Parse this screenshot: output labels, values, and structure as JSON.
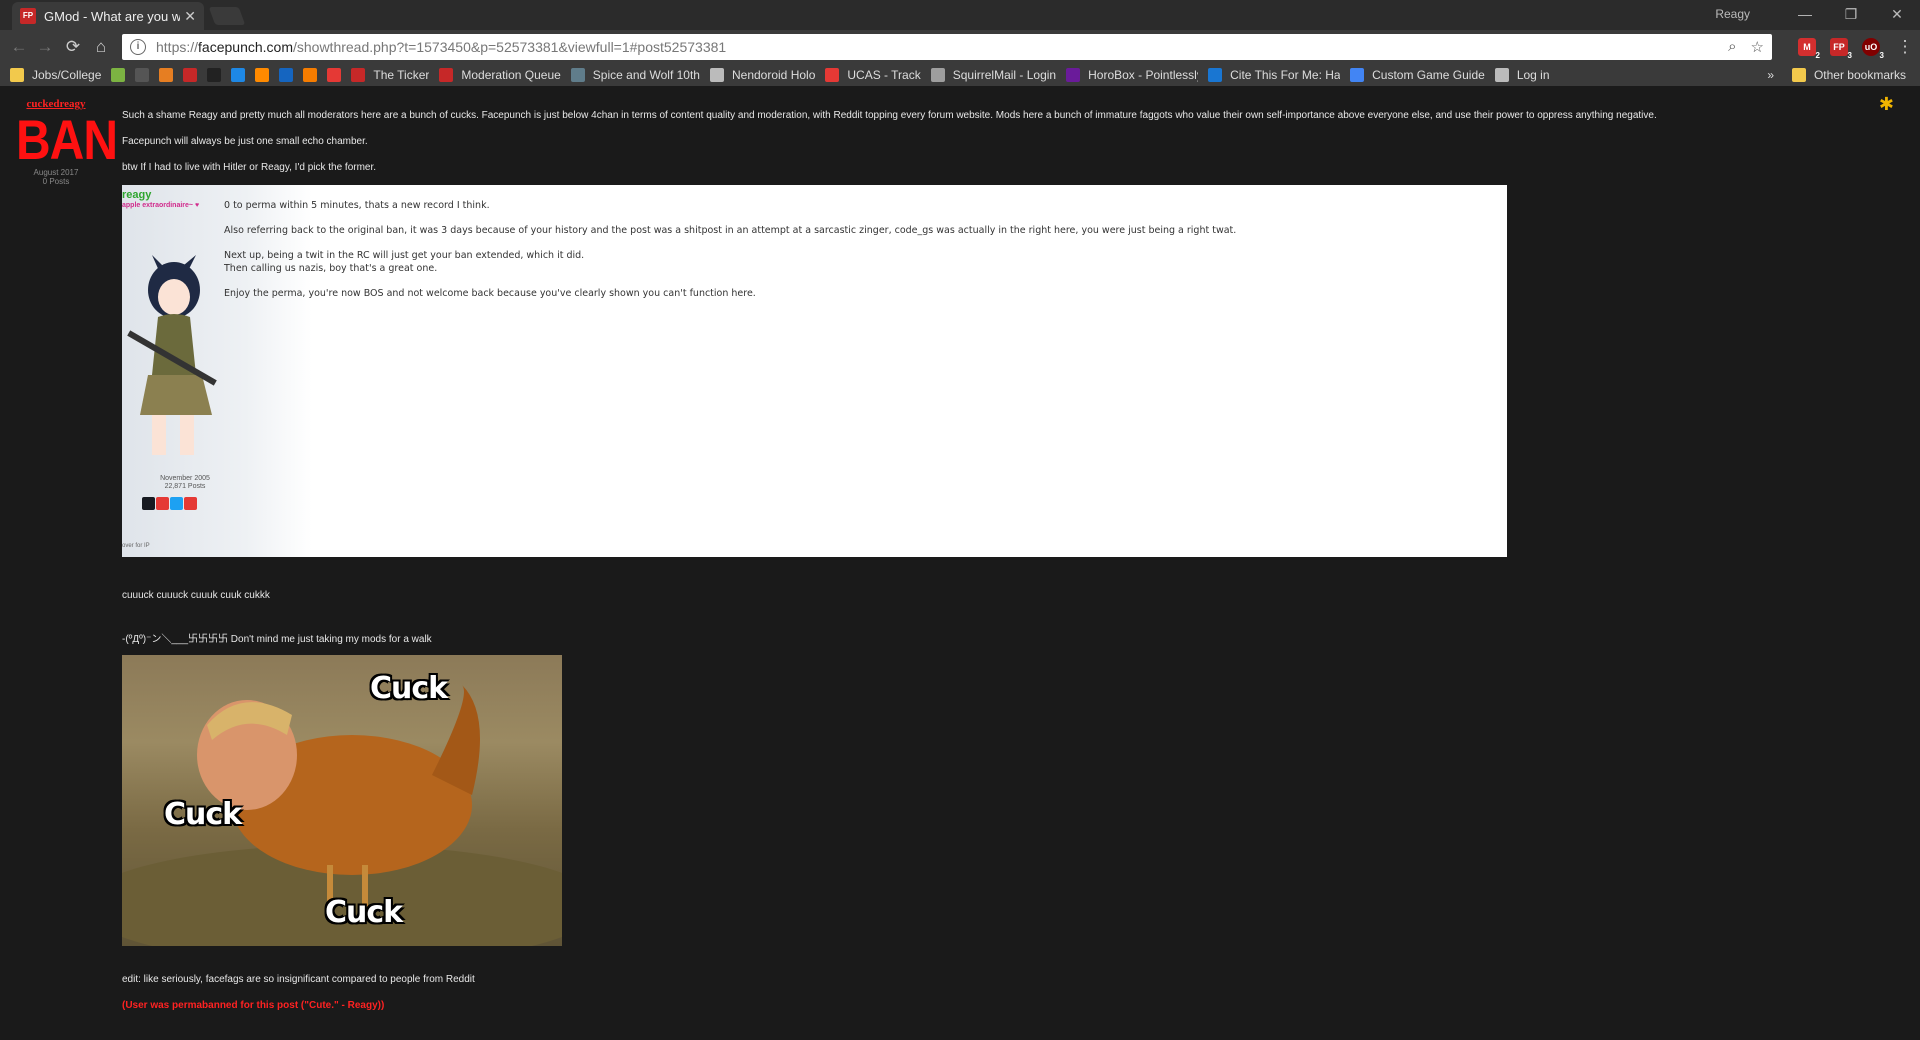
{
  "browser": {
    "tab_title": "GMod - What are you w",
    "favicon_text": "FP",
    "profile_name": "Reagy",
    "url_scheme": "https://",
    "url_host": "facepunch.com",
    "url_path": "/showthread.php?t=1573450&p=52573381&viewfull=1#post52573381",
    "extensions": [
      {
        "name": "gmail-icon",
        "badge": "2",
        "color": "#d32f2f"
      },
      {
        "name": "facepunch-icon",
        "badge": "3",
        "color": "#c62828"
      },
      {
        "name": "ublock-icon",
        "badge": "3",
        "color": "#800000"
      }
    ],
    "bookmarks": [
      {
        "label": "Jobs/College",
        "icon": "folder-icon",
        "color": "#f2c94c"
      },
      {
        "label": "",
        "icon": "bookmark-green-icon",
        "color": "#7cb342"
      },
      {
        "label": "",
        "icon": "bookmark-robot-icon",
        "color": "#555555"
      },
      {
        "label": "",
        "icon": "bookmark-orange-icon",
        "color": "#e67e22"
      },
      {
        "label": "",
        "icon": "bookmark-fp-icon",
        "color": "#c62828"
      },
      {
        "label": "",
        "icon": "amazon-icon",
        "color": "#222222"
      },
      {
        "label": "",
        "icon": "bookmark-blue-icon",
        "color": "#1e88e5"
      },
      {
        "label": "",
        "icon": "bookmark-fox-icon",
        "color": "#ff8a00"
      },
      {
        "label": "",
        "icon": "bookmark-n-icon",
        "color": "#1565c0"
      },
      {
        "label": "",
        "icon": "bookmark-flame-icon",
        "color": "#f57c00"
      },
      {
        "label": "",
        "icon": "youtube-icon",
        "color": "#e53935"
      },
      {
        "label": "The Ticker",
        "icon": "bookmark-fp-icon",
        "color": "#c62828"
      },
      {
        "label": "Moderation Queue",
        "icon": "bookmark-fp-icon",
        "color": "#c62828"
      },
      {
        "label": "Spice and Wolf 10th",
        "icon": "bookmark-x-icon",
        "color": "#607d8b"
      },
      {
        "label": "Nendoroid Holo",
        "icon": "page-icon",
        "color": "#bbbbbb"
      },
      {
        "label": "UCAS - Track",
        "icon": "ucas-icon",
        "color": "#e53935"
      },
      {
        "label": "SquirrelMail - Login",
        "icon": "squirrelmail-icon",
        "color": "#9e9e9e"
      },
      {
        "label": "HoroBox - Pointlessly",
        "icon": "horobox-icon",
        "color": "#6a1b9a"
      },
      {
        "label": "Cite This For Me: Har",
        "icon": "cite-icon",
        "color": "#1976d2"
      },
      {
        "label": "Custom Game Guide",
        "icon": "docs-icon",
        "color": "#4285f4"
      },
      {
        "label": "Log in",
        "icon": "page-icon",
        "color": "#bbbbbb"
      }
    ],
    "other_bookmarks": "Other bookmarks",
    "more_bookmarks": "»"
  },
  "post": {
    "username": "cuckedreagy",
    "ban_label": "BAN",
    "join_date": "August 2017",
    "post_count": "0 Posts",
    "paragraph1": "Such a shame Reagy and pretty much all moderators here are a bunch of cucks. Facepunch is just below 4chan in terms of content quality and moderation, with Reddit topping every forum website. Mods here a bunch of immature faggots who value their own self-importance above everyone else, and use their power to oppress anything negative.",
    "paragraph2": "Facepunch will always be just one small echo chamber.",
    "paragraph3": "btw If I had to live with Hitler or Reagy, I'd pick the former.",
    "quote": {
      "username": "reagy",
      "user_title": "apple extraordinaire~ ♥",
      "join_date": "November 2005",
      "post_count": "22,871 Posts",
      "ip_text": "over for IP",
      "lines": [
        "0 to perma within 5 minutes, thats a new record I think.",
        "",
        "Also referring back to the original ban, it was 3 days because of your history and the post was a shitpost in an attempt at a sarcastic zinger, code_gs was actually in the right here, you were just being a right twat.",
        "",
        "Next up, being a twit in the RC will just get your ban extended, which it did.",
        "Then calling us nazis, boy that's a great one.",
        "",
        "Enjoy the perma, you're now BOS and not welcome back because you've clearly shown you can't function here."
      ]
    },
    "line_cuuuck": "cuuuck cuuuck cuuuk cuuk cukkk",
    "line_walk": "-(ºДº)⁻ン＼___卐卐卐卐 Don't mind me just taking my mods for a walk",
    "image_labels": [
      "Cuck",
      "Cuck",
      "Cuck"
    ],
    "edit_line": "edit: like seriously, facefags are so insignificant compared to people from Reddit",
    "ban_reason": "(User was permabanned for this post (\"Cute.\" - Reagy))"
  }
}
